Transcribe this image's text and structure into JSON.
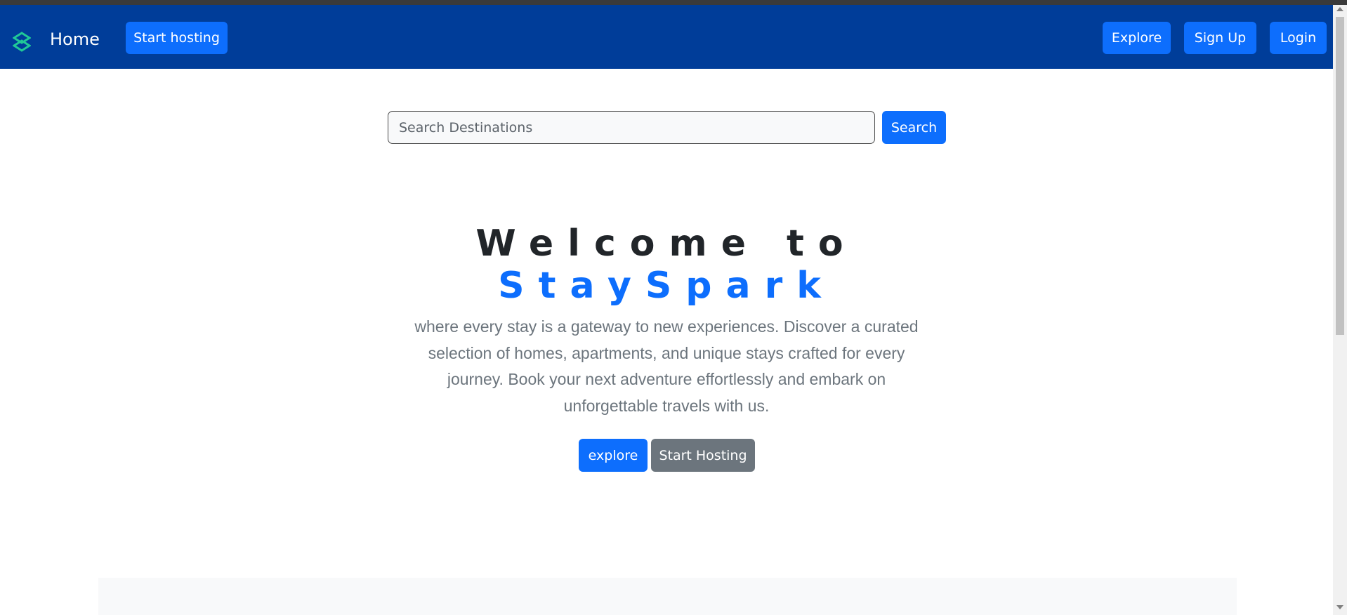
{
  "navbar": {
    "brand_label": "Home",
    "start_hosting_label": "Start hosting",
    "explore_label": "Explore",
    "signup_label": "Sign Up",
    "login_label": "Login",
    "bg_color": "#003d99",
    "brand_icon": "stayspark-logo-icon",
    "brand_icon_color": "#20c997"
  },
  "search": {
    "placeholder": "Search Destinations",
    "button_label": "Search"
  },
  "hero": {
    "title_line1": "Welcome to",
    "title_line2": "StaySpark",
    "tagline": "where every stay is a gateway to new experiences. Discover a curated selection of homes, apartments, and unique stays crafted for every journey. Book your next adventure effortlessly and embark on unforgettable travels with us.",
    "explore_label": "explore",
    "start_hosting_label": "Start Hosting",
    "accent_color": "#0d6efd"
  }
}
